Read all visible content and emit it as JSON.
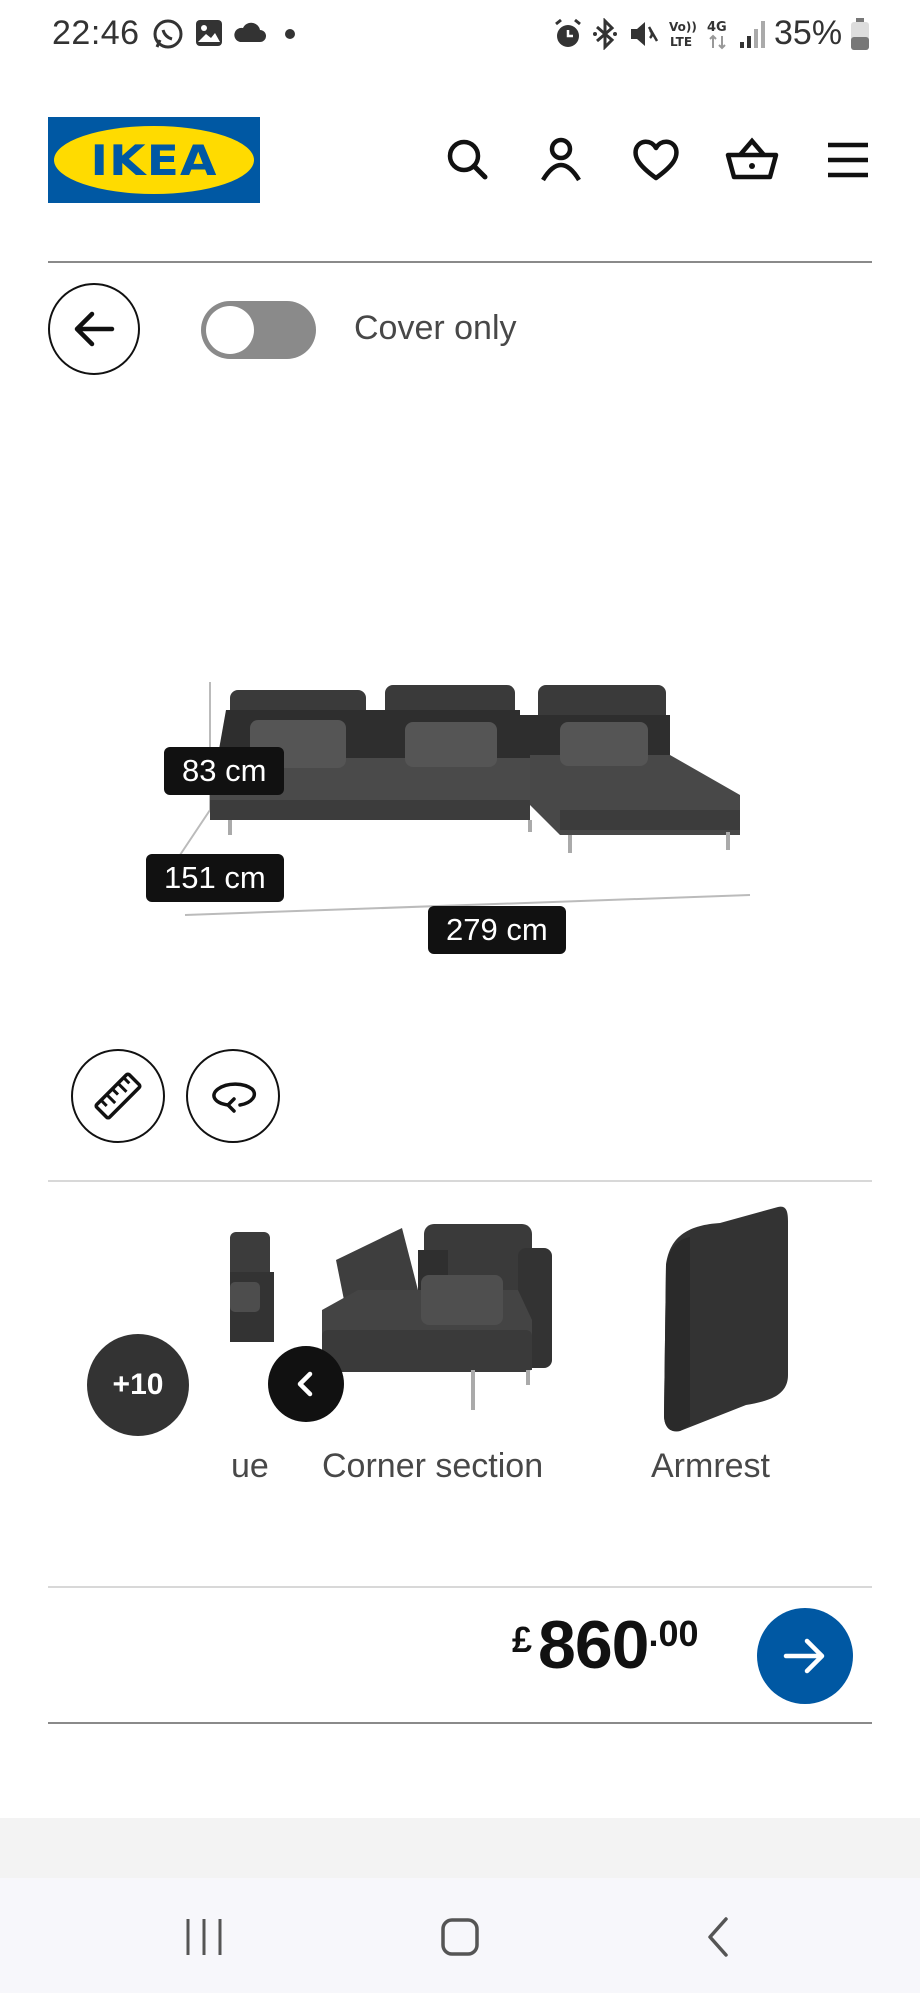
{
  "status_bar": {
    "time": "22:46",
    "battery": "35%",
    "icons": [
      "whatsapp-icon",
      "gallery-icon",
      "cloud-icon",
      "dot-icon",
      "alarm-icon",
      "bluetooth-icon",
      "mute-icon",
      "volte-icon",
      "4g-icon",
      "signal-icon",
      "battery-icon"
    ]
  },
  "header": {
    "logo_text": "IKEA",
    "icons": [
      "search-icon",
      "account-icon",
      "heart-icon",
      "basket-icon",
      "menu-icon"
    ],
    "brand_blue": "#0058a3",
    "brand_yellow": "#ffdb00"
  },
  "toolbar": {
    "toggle_label": "Cover only",
    "toggle_on": false
  },
  "product": {
    "dimensions": {
      "height": "83 cm",
      "depth": "151 cm",
      "width": "279 cm"
    }
  },
  "tools": [
    "measure-icon",
    "rotate-icon"
  ],
  "carousel": {
    "more_count": "+10",
    "items": [
      {
        "label": "ue"
      },
      {
        "label": "Corner section"
      },
      {
        "label": "Armrest"
      }
    ]
  },
  "price": {
    "currency": "£",
    "integer": "860",
    "decimal": ".00"
  },
  "system_nav": [
    "recents-icon",
    "home-icon",
    "back-icon"
  ]
}
